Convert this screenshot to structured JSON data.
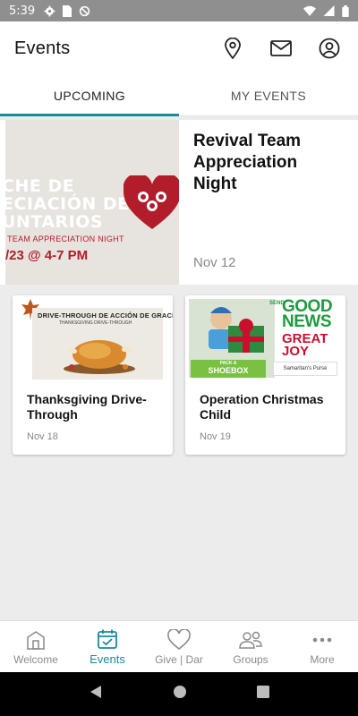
{
  "status_bar": {
    "time": "5:39"
  },
  "header": {
    "title": "Events"
  },
  "tabs": [
    {
      "label": "UPCOMING",
      "active": true
    },
    {
      "label": "MY EVENTS",
      "active": false
    }
  ],
  "featured": {
    "title": "Revival Team Appreciation Night",
    "date": "Nov 12",
    "image": {
      "line1": "CHE DE",
      "line2": "ECIACIÓN DE",
      "line3": "UNTARIOS",
      "line4": "TEAM APPRECIATION NIGHT",
      "line5": "/23 @ 4-7 PM"
    }
  },
  "cards": [
    {
      "title": "Thanksgiving Drive-Through",
      "date": "Nov 18",
      "image": {
        "headline": "DRIVE-THROUGH DE ACCIÓN DE GRACIAS",
        "sub": "THANKSGIVING DRIVE-THROUGH"
      }
    },
    {
      "title": "Operation Christmas Child",
      "date": "Nov 19",
      "image": {
        "send": "SEND",
        "good_news": "GOOD NEWS",
        "of": "OF",
        "great_joy": "GREAT JOY",
        "pack_a": "PACK A",
        "shoebox": "SHOEBOX",
        "org": "Samaritan's Purse"
      }
    }
  ],
  "bottom_nav": [
    {
      "label": "Welcome",
      "icon": "building-icon",
      "active": false
    },
    {
      "label": "Events",
      "icon": "calendar-check-icon",
      "active": true
    },
    {
      "label": "Give | Dar",
      "icon": "heart-icon",
      "active": false
    },
    {
      "label": "Groups",
      "icon": "people-icon",
      "active": false
    },
    {
      "label": "More",
      "icon": "more-dots-icon",
      "active": false
    }
  ],
  "colors": {
    "accent": "#1a8a9c",
    "status_bar": "#8f8f8f",
    "background": "#ececec",
    "brand_red": "#b11d2a"
  }
}
